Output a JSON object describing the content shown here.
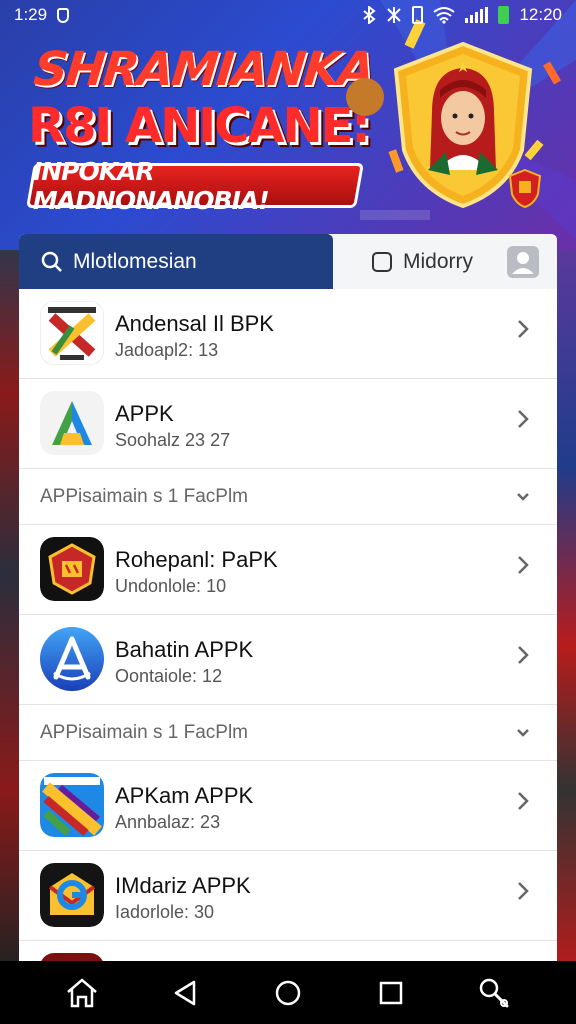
{
  "status": {
    "time_left": "1:29",
    "time_right": "12:20"
  },
  "banner": {
    "line1": "SHRAMIANKA",
    "line2": "R8I ANICANE:",
    "ribbon": "INPOKAR MADNONANOBIA!"
  },
  "tabs": {
    "search_label": "Mlotlomesian",
    "other_label": "Midorry"
  },
  "items": [
    {
      "title": "Andensal Il BPK",
      "subtitle": "Jadoapl2: 13"
    },
    {
      "title": "APPK",
      "subtitle": "Soohalz 23 27"
    },
    {
      "title": "Rohepanl: PaPK",
      "subtitle": "Undonlole: 10"
    },
    {
      "title": "Bahatin APPK",
      "subtitle": "Oontaiole: 12"
    },
    {
      "title": "APKam APPK",
      "subtitle": "Annbalaz: 23"
    },
    {
      "title": "IMdariz APPK",
      "subtitle": "Iadorlole: 30"
    }
  ],
  "sections": [
    {
      "label": "APPisaimain s 1 FacPlm"
    },
    {
      "label": "APPisaimain s 1 FacPlm"
    }
  ],
  "colors": {
    "tab_active": "#1f3f82",
    "banner_red": "#ff2a2a",
    "list_bg": "#ffffff"
  },
  "icons": {
    "status": [
      "shield-icon",
      "bluetooth-icon",
      "vibrate-icon",
      "battery-icon",
      "wifi-icon",
      "signal-icon"
    ],
    "nav": [
      "home-icon",
      "back-icon",
      "home-circle-icon",
      "recents-icon",
      "search-icon"
    ]
  }
}
